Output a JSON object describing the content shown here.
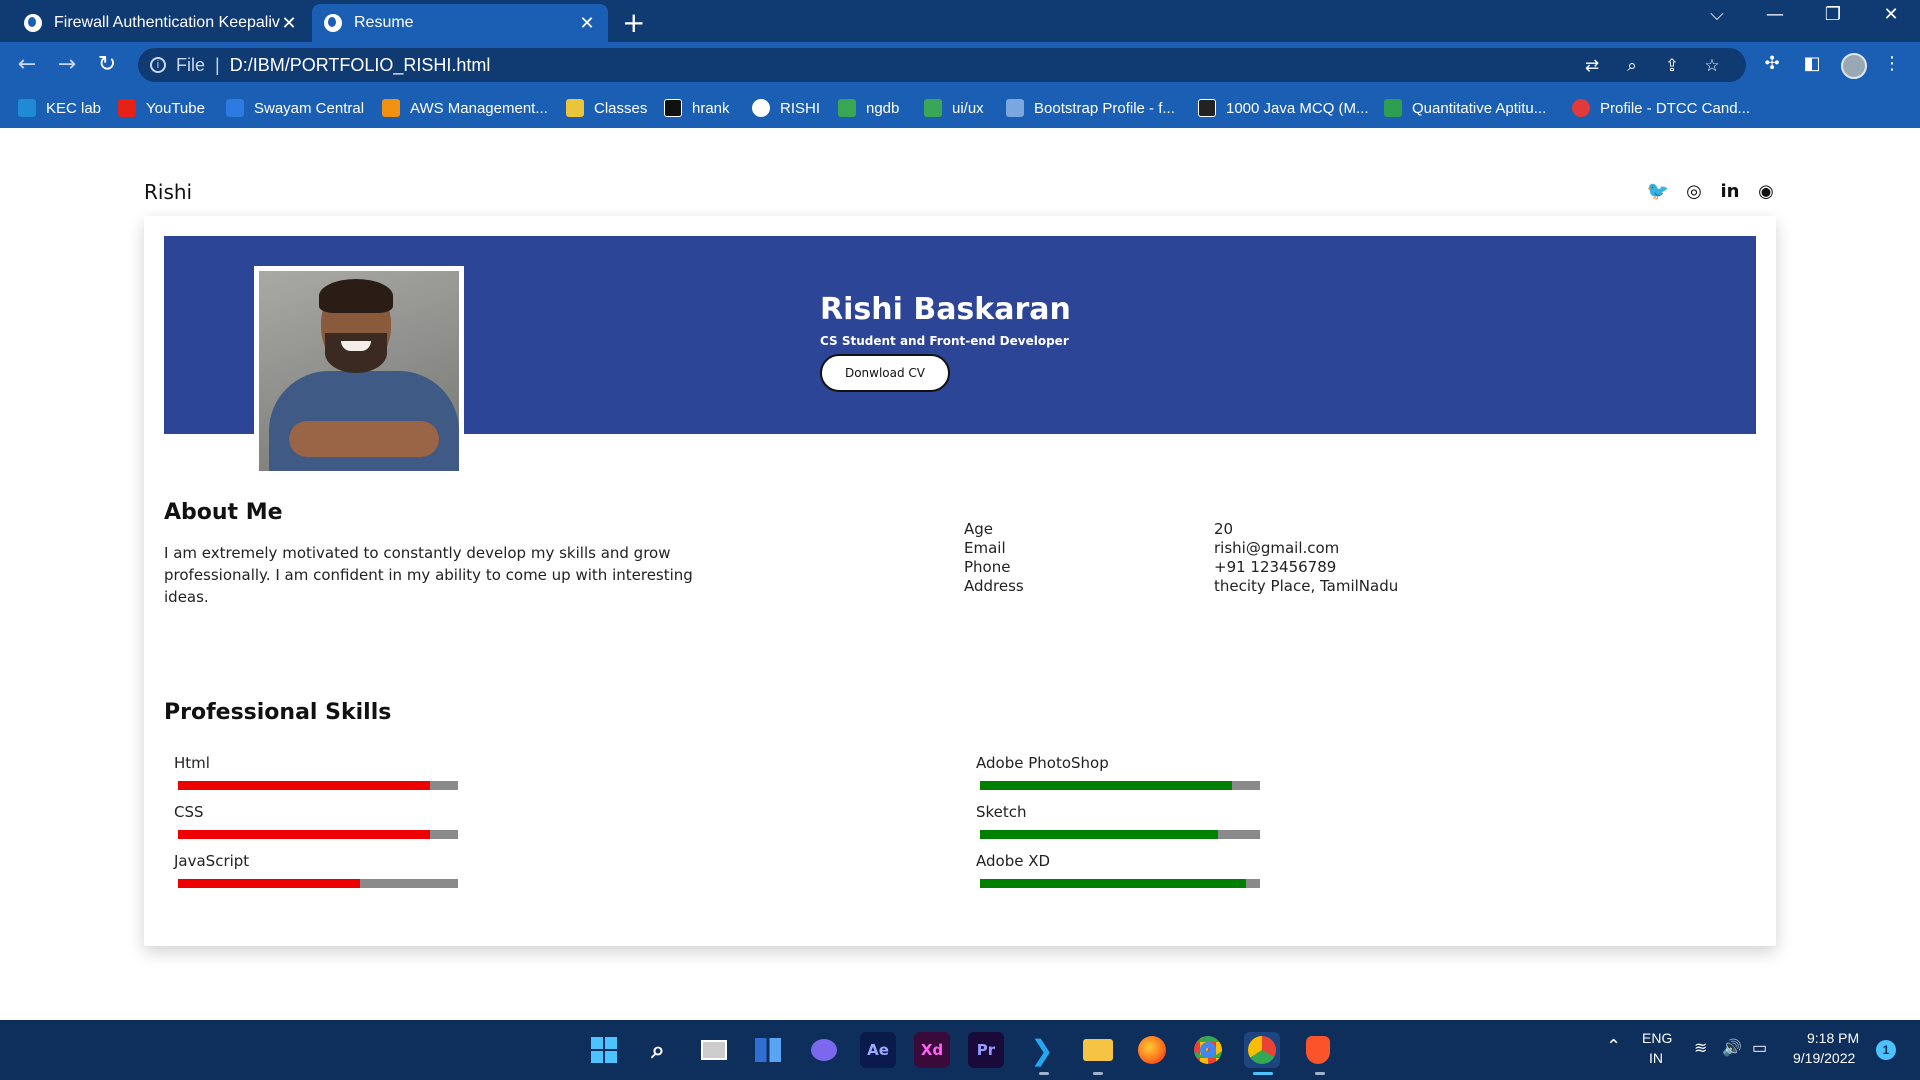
{
  "browser": {
    "tabs": [
      {
        "title": "Firewall Authentication Keepalive",
        "close": "✕"
      },
      {
        "title": "Resume",
        "close": "✕"
      }
    ],
    "new_tab": "+",
    "window_controls": {
      "dropdown": "⌵",
      "minimize": "—",
      "restore": "❐",
      "close": "✕"
    },
    "nav": {
      "back": "←",
      "forward": "→",
      "reload": "↻"
    },
    "address": {
      "info_icon": "i",
      "scheme": "File",
      "separator": "|",
      "url": "D:/IBM/PORTFOLIO_RISHI.html"
    },
    "bookmarks": [
      {
        "label": "KEC lab",
        "color": "#1f8ad6"
      },
      {
        "label": "YouTube",
        "color": "#e62117"
      },
      {
        "label": "Swayam Central",
        "color": "#2d7ae0"
      },
      {
        "label": "AWS Management...",
        "color": "#f29111"
      },
      {
        "label": "Classes",
        "color": "#e8c53a"
      },
      {
        "label": "hrank",
        "color": "#111111"
      },
      {
        "label": "RISHI",
        "color": "#ffffff"
      },
      {
        "label": "ngdb",
        "color": "#3aa757"
      },
      {
        "label": "ui/ux",
        "color": "#3aa757"
      },
      {
        "label": "Bootstrap Profile - f...",
        "color": "#7aa7e0"
      },
      {
        "label": "1000 Java MCQ (M...",
        "color": "#222222"
      },
      {
        "label": "Quantitative Aptitu...",
        "color": "#2e9e50"
      },
      {
        "label": "Profile - DTCC Cand...",
        "color": "#e23a3a"
      }
    ]
  },
  "page": {
    "brand": "Rishi",
    "social_icons": [
      "twitter-icon",
      "instagram-icon",
      "linkedin-icon",
      "github-icon"
    ],
    "hero": {
      "name": "Rishi Baskaran",
      "role": "CS Student and Front-end Developer",
      "cv_button": "Donwload CV",
      "banner_color": "#2d4597"
    },
    "about": {
      "title": "About Me",
      "text": "I am extremely motivated to constantly develop my skills and grow professionally. I am confident in my ability to come up with interesting ideas."
    },
    "info": [
      {
        "label": "Age",
        "value": "20"
      },
      {
        "label": "Email",
        "value": "rishi@gmail.com"
      },
      {
        "label": "Phone",
        "value": "+91 123456789"
      },
      {
        "label": "Address",
        "value": "thecity Place, TamilNadu"
      }
    ],
    "skills": {
      "title": "Professional Skills",
      "left": [
        {
          "name": "Html",
          "level": 0.9,
          "color": "#ee0000"
        },
        {
          "name": "CSS",
          "level": 0.9,
          "color": "#ee0000"
        },
        {
          "name": "JavaScript",
          "level": 0.65,
          "color": "#ee0000"
        }
      ],
      "right": [
        {
          "name": "Adobe PhotoShop",
          "level": 0.9,
          "color": "#008000"
        },
        {
          "name": "Sketch",
          "level": 0.85,
          "color": "#008000"
        },
        {
          "name": "Adobe XD",
          "level": 0.95,
          "color": "#008000"
        }
      ],
      "track_color": "#8a8a8a"
    }
  },
  "taskbar": {
    "apps": [
      "windows-start",
      "search",
      "task-view",
      "widgets",
      "chat",
      "Ae",
      "Xd",
      "Pr",
      "vscode",
      "file-explorer",
      "firefox",
      "chrome",
      "chrome-dev",
      "brave"
    ],
    "tray": {
      "lang_top": "ENG",
      "lang_bottom": "IN",
      "time": "9:18 PM",
      "date": "9/19/2022",
      "notifications": "1"
    }
  }
}
